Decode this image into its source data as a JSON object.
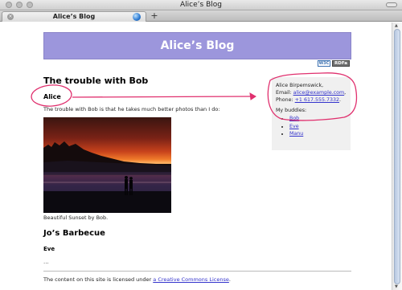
{
  "window": {
    "title": "Alice’s Blog"
  },
  "tabs": [
    {
      "label": "Alice’s Blog"
    }
  ],
  "page": {
    "banner_title": "Alice’s Blog",
    "badges": [
      "W3C",
      "RDFa"
    ],
    "post1": {
      "title": "The trouble with Bob",
      "author": "Alice",
      "text": "The trouble with Bob is that he takes much better photos than I do:",
      "caption": "Beautiful Sunset by Bob."
    },
    "post2": {
      "title": "Jo’s Barbecue",
      "author": "Eve",
      "excerpt": "..."
    },
    "vcard": {
      "name": "Alice Birpemswick,",
      "email_label": "Email:",
      "email": "alice@example.com",
      "phone_label": "Phone:",
      "phone": "+1 617.555.7332",
      "buddies_label": "My buddies:",
      "buddies": [
        "Bob",
        "Eve",
        "Manu"
      ]
    },
    "footer": {
      "text": "The content on this site is licensed under",
      "license_link": "a Creative Commons License"
    }
  },
  "colors": {
    "banner": "#9c96dc",
    "annotation": "#e0306e",
    "link": "#3333cc"
  }
}
